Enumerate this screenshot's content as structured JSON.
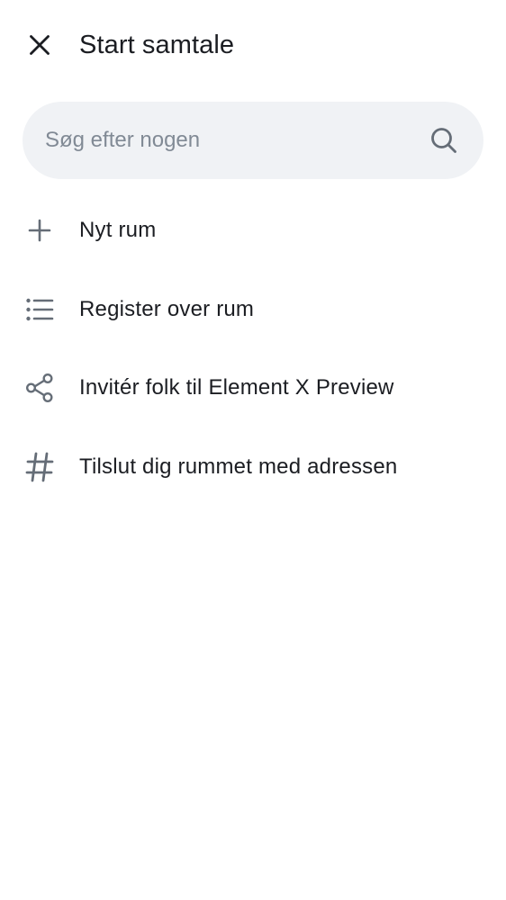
{
  "header": {
    "title": "Start samtale",
    "close_icon": "close-icon"
  },
  "search": {
    "placeholder": "Søg efter nogen",
    "value": "",
    "icon": "search-icon"
  },
  "menu": {
    "items": [
      {
        "label": "Nyt rum",
        "icon": "plus-icon"
      },
      {
        "label": "Register over rum",
        "icon": "list-icon"
      },
      {
        "label": "Invitér folk til Element X Preview",
        "icon": "share-icon"
      },
      {
        "label": "Tilslut dig rummet med adressen",
        "icon": "hash-icon"
      }
    ]
  },
  "colors": {
    "text": "#1b1d22",
    "icon": "#656d77",
    "search_bg": "#f0f2f5",
    "placeholder": "#818a95",
    "background": "#ffffff"
  }
}
